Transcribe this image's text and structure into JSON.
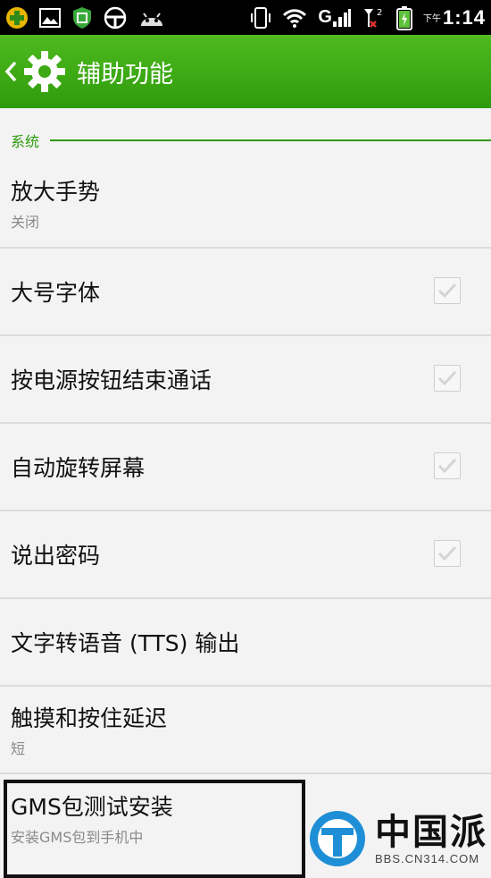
{
  "status_bar": {
    "network_letter": "G",
    "sim_slot": "2",
    "ampm": "下午",
    "time": "1:14"
  },
  "action_bar": {
    "title": "辅助功能"
  },
  "section": {
    "label": "系统"
  },
  "items": [
    {
      "title": "放大手势",
      "subtitle": "关闭",
      "checkbox": false
    },
    {
      "title": "大号字体",
      "subtitle": "",
      "checkbox": true
    },
    {
      "title": "按电源按钮结束通话",
      "subtitle": "",
      "checkbox": true
    },
    {
      "title": "自动旋转屏幕",
      "subtitle": "",
      "checkbox": true
    },
    {
      "title": "说出密码",
      "subtitle": "",
      "checkbox": true
    },
    {
      "title": "文字转语音 (TTS) 输出",
      "subtitle": "",
      "checkbox": false
    },
    {
      "title": "触摸和按住延迟",
      "subtitle": "短",
      "checkbox": false
    },
    {
      "title": "GMS包测试安装",
      "subtitle": "安装GMS包到手机中",
      "checkbox": false
    }
  ],
  "watermark": {
    "name": "中国派",
    "url": "BBS.CN314.COM"
  },
  "colors": {
    "accent": "#2e9b0d",
    "action_bar_top": "#4fbb1f",
    "background": "#f3f3f3"
  }
}
